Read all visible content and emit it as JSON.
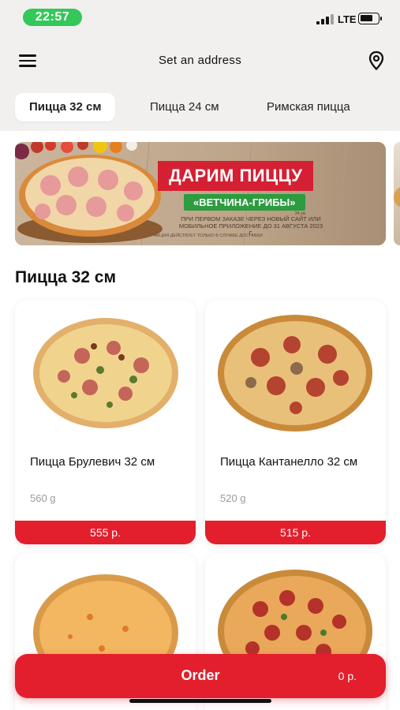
{
  "status_bar": {
    "time": "22:57",
    "network": "LTE",
    "battery_level": 0.75
  },
  "header": {
    "address": "Set an address",
    "menu_icon": "hamburger-menu-icon",
    "location_icon": "location-pin-icon"
  },
  "tabs": [
    {
      "label": "Пицца 32 см",
      "active": true
    },
    {
      "label": "Пицца 24 см",
      "active": false
    },
    {
      "label": "Римская пицца",
      "active": false
    }
  ],
  "banner": {
    "title": "ДАРИМ ПИЦЦУ",
    "subtitle": "«ВЕТЧИНА-ГРИБЫ»",
    "size_note": "24 см",
    "note": "ПРИ ПЕРВОМ ЗАКАЗЕ ЧЕРЕЗ НОВЫЙ САЙТ ИЛИ МОБИЛЬНОЕ ПРИЛОЖЕНИЕ ДО 31 АВГУСТА 2023 Г.",
    "fine_print": "АКЦИЯ ДЕЙСТВУЕТ ТОЛЬКО В СЛУЖБЕ ДОСТАВКИ",
    "colors": {
      "title_bg": "#d52033",
      "subtitle_bg": "#2d9b3f"
    }
  },
  "section": {
    "title": "Пицца 32 см"
  },
  "products": [
    {
      "name": "Пицца Брулевич 32 см",
      "weight": "560 g",
      "price": "555 р."
    },
    {
      "name": "Пицца Кантанелло 32 см",
      "weight": "520 g",
      "price": "515 р."
    },
    {
      "name": "",
      "weight": "",
      "price": ""
    },
    {
      "name": "",
      "weight": "",
      "price": ""
    }
  ],
  "order": {
    "label": "Order",
    "total": "0 р."
  },
  "colors": {
    "accent": "#e31e2d",
    "background": "#f1f0ee",
    "time_pill": "#34c759"
  }
}
